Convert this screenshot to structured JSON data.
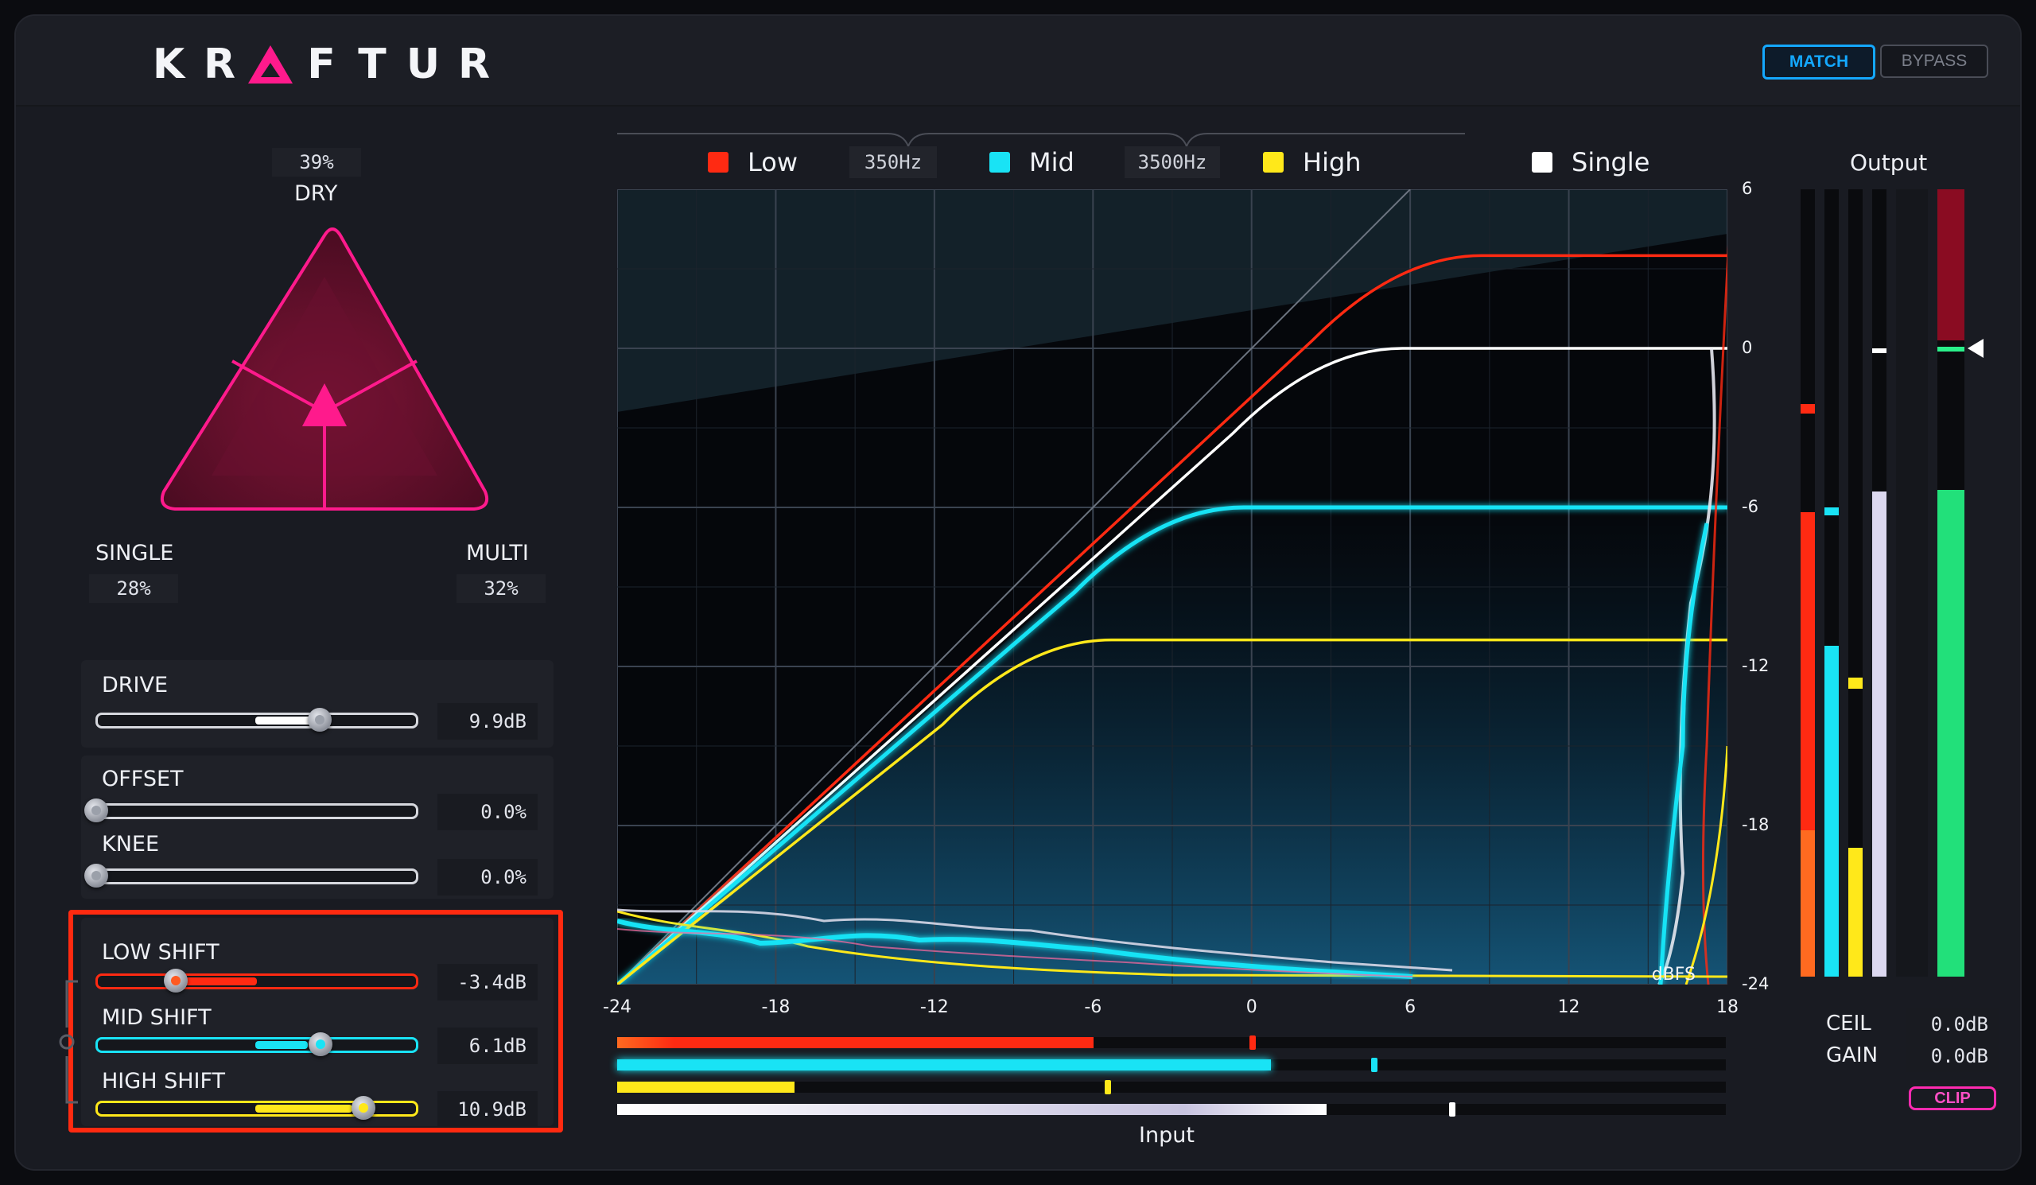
{
  "header": {
    "logo_letters": [
      "K",
      "R",
      "A",
      "F",
      "T",
      "U",
      "R"
    ],
    "match_label": "MATCH",
    "bypass_label": "BYPASS"
  },
  "mix": {
    "dry_label": "DRY",
    "dry_value": "39%",
    "single_label": "SINGLE",
    "single_value": "28%",
    "multi_label": "MULTI",
    "multi_value": "32%"
  },
  "controls": {
    "drive": {
      "label": "DRIVE",
      "value": "9.9dB",
      "level": 0.7
    },
    "offset": {
      "label": "OFFSET",
      "value": "0.0%",
      "level": 0.0
    },
    "knee": {
      "label": "KNEE",
      "value": "0.0%",
      "level": 0.0
    },
    "low_shift": {
      "label": "LOW SHIFT",
      "value": "-3.4dB",
      "level": 0.22
    },
    "mid_shift": {
      "label": "MID SHIFT",
      "value": "6.1dB",
      "level": 0.66
    },
    "high_shift": {
      "label": "HIGH SHIFT",
      "value": "10.9dB",
      "level": 0.8
    }
  },
  "legend": {
    "low": "Low",
    "mid": "Mid",
    "high": "High",
    "single": "Single",
    "crossover1": "350Hz",
    "crossover2": "3500Hz"
  },
  "colors": {
    "low": "#ff2a12",
    "mid": "#19e3f5",
    "high": "#ffe81a",
    "single": "#ffffff",
    "accent": "#ff1a8c",
    "match": "#14a8ff"
  },
  "chart_data": {
    "type": "line",
    "xlabel": "Input",
    "ylabel": "",
    "unit_label": "dBFS",
    "xlim": [
      -24,
      18
    ],
    "ylim": [
      -24,
      6
    ],
    "x_ticks": [
      "-24",
      "-18",
      "-12",
      "-6",
      "0",
      "6",
      "12",
      "18"
    ],
    "y_ticks": [
      "6",
      "0",
      "-6",
      "-12",
      "-18",
      "-24"
    ],
    "series": [
      {
        "name": "Low",
        "x": [
          -24,
          5.5,
          18
        ],
        "y": [
          -24,
          3.5,
          3.5
        ]
      },
      {
        "name": "Single",
        "x": [
          -24,
          2.5,
          18
        ],
        "y": [
          -24,
          0,
          0
        ]
      },
      {
        "name": "Mid",
        "x": [
          -24,
          -3.5,
          18
        ],
        "y": [
          -24,
          -6,
          -6
        ]
      },
      {
        "name": "High",
        "x": [
          -24,
          -8.5,
          18
        ],
        "y": [
          -24,
          -11,
          -11
        ]
      }
    ]
  },
  "input_meters": [
    {
      "band": "low",
      "level": 0.43,
      "peak": 0.57
    },
    {
      "band": "mid",
      "level": 0.59,
      "peak": 0.68
    },
    {
      "band": "high",
      "level": 0.16,
      "peak": 0.44
    },
    {
      "band": "single",
      "level": 0.64,
      "peak": 0.75
    }
  ],
  "output": {
    "title": "Output",
    "ceil_label": "CEIL",
    "ceil_value": "0.0dB",
    "gain_label": "GAIN",
    "gain_value": "0.0dB",
    "clip_label": "CLIP"
  }
}
